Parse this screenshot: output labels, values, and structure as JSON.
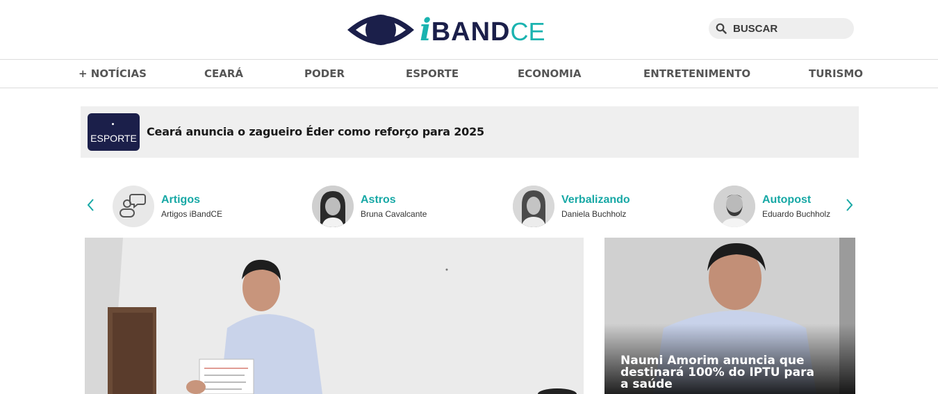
{
  "header": {
    "logo": {
      "i": "i",
      "band": "BAND",
      "ce": "CE"
    },
    "search": {
      "placeholder": "BUSCAR",
      "icon": "search-icon"
    }
  },
  "nav": {
    "items": [
      {
        "label": "+ NOTÍCIAS"
      },
      {
        "label": "CEARÁ"
      },
      {
        "label": "PODER"
      },
      {
        "label": "ESPORTE"
      },
      {
        "label": "ECONOMIA"
      },
      {
        "label": "ENTRETENIMENTO"
      },
      {
        "label": "TURISMO"
      }
    ]
  },
  "ticker": {
    "category": "ESPORTE",
    "headline": "Ceará anuncia o zagueiro Éder como reforço para 2025"
  },
  "columnists": {
    "prev_icon": "chevron-left-icon",
    "next_icon": "chevron-right-icon",
    "items": [
      {
        "name": "Artigos",
        "author": "Artigos iBandCE"
      },
      {
        "name": "Astros",
        "author": "Bruna Cavalcante"
      },
      {
        "name": "Verbalizando",
        "author": "Daniela Buchholz"
      },
      {
        "name": "Autopost",
        "author": "Eduardo Buchholz"
      }
    ]
  },
  "featured": {
    "side_title": "Naumi Amorim anuncia que destinará 100% do IPTU para a saúde"
  },
  "colors": {
    "brand_navy": "#1b1f4a",
    "brand_teal": "#1ab3b0",
    "nav_text": "#555555"
  }
}
